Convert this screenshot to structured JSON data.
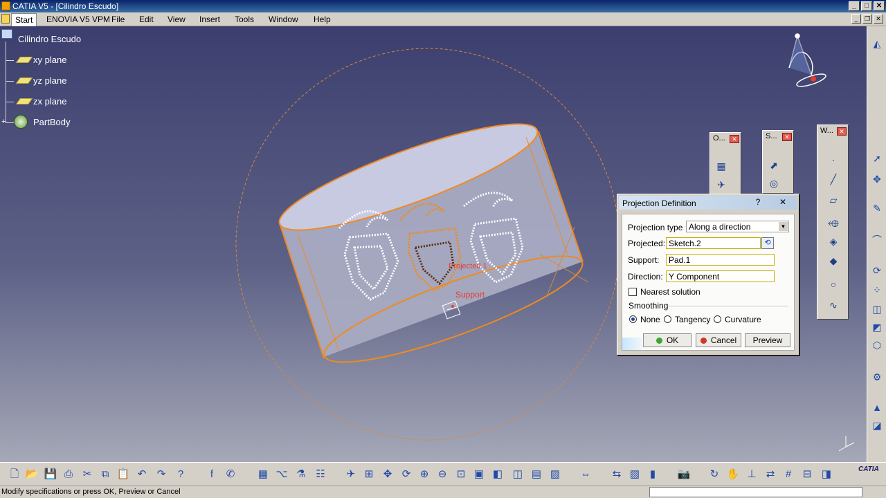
{
  "window": {
    "title": "CATIA V5 - [Cilindro Escudo]"
  },
  "menu": {
    "items": [
      "Start",
      "ENOVIA V5 VPM",
      "File",
      "Edit",
      "View",
      "Insert",
      "Tools",
      "Window",
      "Help"
    ]
  },
  "tree": {
    "root": "Cilindro Escudo",
    "children": [
      "xy plane",
      "yz plane",
      "zx plane",
      "PartBody"
    ]
  },
  "viewport_labels": {
    "projected": "Projected.1",
    "support": "Support"
  },
  "toolbars": {
    "operations_title": "O...",
    "surfaces_title": "S...",
    "wireframe_title": "W..."
  },
  "dialog": {
    "title": "Projection Definition",
    "help": "?",
    "close": "✕",
    "projection_type_label": "Projection type :",
    "projection_type_value": "Along a direction",
    "projected_label": "Projected:",
    "projected_value": "Sketch.2",
    "support_label": "Support:",
    "support_value": "Pad.1",
    "direction_label": "Direction:",
    "direction_value": "Y Component",
    "nearest_label": "Nearest solution",
    "nearest_checked": false,
    "smoothing_label": "Smoothing",
    "smoothing_options": [
      "None",
      "Tangency",
      "Curvature"
    ],
    "smoothing_selected": "None",
    "ok": "OK",
    "cancel": "Cancel",
    "preview": "Preview"
  },
  "status": {
    "message": "Modify specifications or press OK, Preview or Cancel"
  },
  "icons": {
    "bottom": [
      "new-icon",
      "open-icon",
      "save-icon",
      "print-icon",
      "cut-icon",
      "copy-icon",
      "paste-icon",
      "undo-icon",
      "redo-icon",
      "whats-this-icon",
      "formula-icon",
      "comment-icon",
      "catalog-icon",
      "tree-icon",
      "knowledge-icon",
      "table-icon",
      "fly-icon",
      "fit-all-icon",
      "pan-icon",
      "rotate-icon",
      "zoom-in-icon",
      "zoom-out-icon",
      "normal-view-icon",
      "iso-view-icon",
      "shading-icon",
      "hide-show-icon",
      "swap-icon",
      "sketcher-icon",
      "measure-icon",
      "apply-material-icon",
      "photo-icon",
      "update-icon",
      "grab-icon",
      "axis-icon",
      "grid-icon",
      "snap-icon",
      "surface-icon"
    ],
    "right": [
      "part-design-icon",
      "select-arrow-icon",
      "compass-icon",
      "sketch-icon",
      "curve-icon",
      "constraint-icon",
      "analysis-icon",
      "boolean-icon",
      "dress-up-icon",
      "transform-icon",
      "knowledge-advisor-icon",
      "generative-shape-icon",
      "pattern-icon",
      "annotation-icon"
    ]
  },
  "colors": {
    "accent": "#f08a1e",
    "tree_text": "#ffffff",
    "title_bar": "#0a246a"
  }
}
